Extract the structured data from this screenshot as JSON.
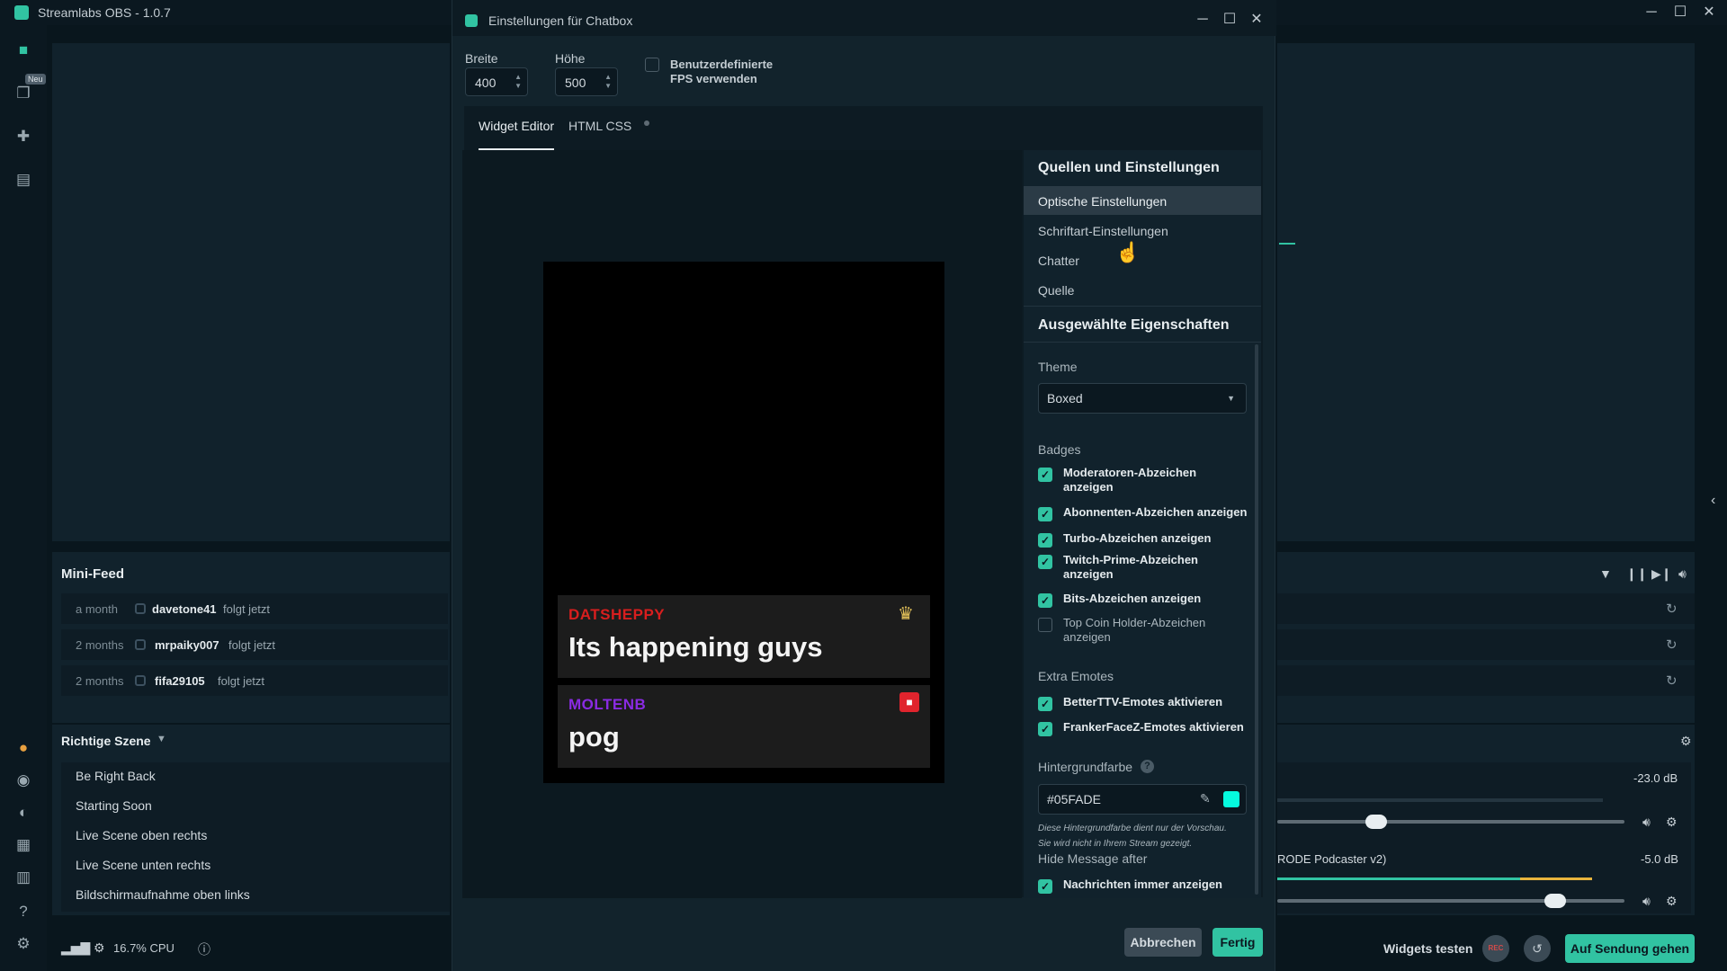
{
  "app": {
    "title": "Streamlabs OBS - 1.0.7",
    "nav_badge": "Neu"
  },
  "minifeed": {
    "title": "Mini-Feed",
    "rows": [
      {
        "time": "a month",
        "name": "davetone41",
        "action": "folgt jetzt"
      },
      {
        "time": "2 months",
        "name": "mrpaiky007",
        "action": "folgt jetzt"
      },
      {
        "time": "2 months",
        "name": "fifa29105",
        "action": "folgt jetzt"
      }
    ]
  },
  "scenes": {
    "title": "Richtige Szene",
    "items": [
      "Be Right Back",
      "Starting Soon",
      "Live Scene oben rechts",
      "Live Scene unten rechts",
      "Bildschirmaufnahme oben links"
    ]
  },
  "mixer": {
    "db1": "-23.0 dB",
    "source2": "RODE Podcaster v2)",
    "db2": "-5.0 dB",
    "slider1_level": 0.27,
    "slider2_level": 0.82
  },
  "status": {
    "cpu": "16.7% CPU",
    "test_widgets": "Widgets testen",
    "rec": "REC",
    "go_live": "Auf Sendung gehen"
  },
  "dialog": {
    "title": "Einstellungen für Chatbox",
    "width_label": "Breite",
    "width_value": "400",
    "height_label": "Höhe",
    "height_value": "500",
    "fps_label_1": "Benutzerdefinierte",
    "fps_label_2": "FPS verwenden",
    "tabs": [
      "Widget Editor",
      "HTML CSS"
    ],
    "preview": {
      "messages": [
        {
          "name": "DATSHEPPY",
          "text": "Its happening guys",
          "name_color": "#d81e1e"
        },
        {
          "name": "MOLTENB",
          "text": "pog",
          "name_color": "#8a2be2"
        }
      ]
    },
    "settings": {
      "sources_heading": "Quellen und Einstellungen",
      "menu": [
        "Optische Einstellungen",
        "Schriftart-Einstellungen",
        "Chatter",
        "Quelle"
      ],
      "selected_heading": "Ausgewählte Eigenschaften",
      "theme_label": "Theme",
      "theme_value": "Boxed",
      "badges_label": "Badges",
      "badges": [
        {
          "line1": "Moderatoren-Abzeichen",
          "line2": "anzeigen",
          "checked": true
        },
        {
          "line1": "Abonnenten-Abzeichen anzeigen",
          "line2": "",
          "checked": true
        },
        {
          "line1": "Turbo-Abzeichen anzeigen",
          "line2": "",
          "checked": true
        },
        {
          "line1": "Twitch-Prime-Abzeichen",
          "line2": "anzeigen",
          "checked": true
        },
        {
          "line1": "Bits-Abzeichen anzeigen",
          "line2": "",
          "checked": true
        },
        {
          "line1": "Top Coin Holder-Abzeichen",
          "line2": "anzeigen",
          "checked": false
        }
      ],
      "extra_label": "Extra Emotes",
      "extras": [
        {
          "label": "BetterTTV-Emotes aktivieren",
          "checked": true
        },
        {
          "label": "FrankerFaceZ-Emotes aktivieren",
          "checked": true
        }
      ],
      "bg_label": "Hintergrundfarbe",
      "bg_value": "#05FADE",
      "bg_note_1": "Diese Hintergrundfarbe dient nur der Vorschau.",
      "bg_note_2": "Sie wird nicht in Ihrem Stream gezeigt.",
      "hide_label": "Hide Message after",
      "always_show": "Nachrichten immer anzeigen"
    },
    "cancel": "Abbrechen",
    "done": "Fertig"
  },
  "colors": {
    "accent": "#31c3a2",
    "swatch": "#05FADE"
  }
}
